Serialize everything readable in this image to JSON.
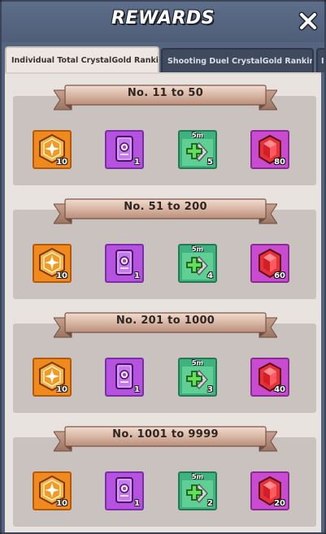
{
  "header": {
    "title": "REWARDS"
  },
  "tabs": [
    {
      "label": "Individual Total CrystalGold Ranking",
      "active": true
    },
    {
      "label": "Shooting Duel CrystalGold Ranking",
      "active": false
    },
    {
      "label": "I",
      "active": false
    }
  ],
  "sections": [
    {
      "label": "No. 11 to 50",
      "items": [
        {
          "icon": "badge-icon",
          "qty": "10"
        },
        {
          "icon": "card-icon",
          "qty": "1"
        },
        {
          "icon": "speedup-icon",
          "qty": "5",
          "badge": "5m"
        },
        {
          "icon": "ruby-icon",
          "qty": "80"
        }
      ]
    },
    {
      "label": "No. 51 to 200",
      "items": [
        {
          "icon": "badge-icon",
          "qty": "10"
        },
        {
          "icon": "card-icon",
          "qty": "1"
        },
        {
          "icon": "speedup-icon",
          "qty": "4",
          "badge": "5m"
        },
        {
          "icon": "ruby-icon",
          "qty": "60"
        }
      ]
    },
    {
      "label": "No. 201 to 1000",
      "items": [
        {
          "icon": "badge-icon",
          "qty": "10"
        },
        {
          "icon": "card-icon",
          "qty": "1"
        },
        {
          "icon": "speedup-icon",
          "qty": "3",
          "badge": "5m"
        },
        {
          "icon": "ruby-icon",
          "qty": "40"
        }
      ]
    },
    {
      "label": "No. 1001 to 9999",
      "items": [
        {
          "icon": "badge-icon",
          "qty": "10"
        },
        {
          "icon": "card-icon",
          "qty": "1"
        },
        {
          "icon": "speedup-icon",
          "qty": "2",
          "badge": "5m"
        },
        {
          "icon": "ruby-icon",
          "qty": "20"
        }
      ]
    }
  ],
  "colors": {
    "frame": "#55657f",
    "panel": "#e8e3de",
    "section": "#cac2be",
    "ribbon": "#d8b3a3",
    "badge_tile": "#f08a1f",
    "card_tile": "#b553e0",
    "speedup_tile": "#3fb27f",
    "ruby_tile": "#c84bd0"
  }
}
